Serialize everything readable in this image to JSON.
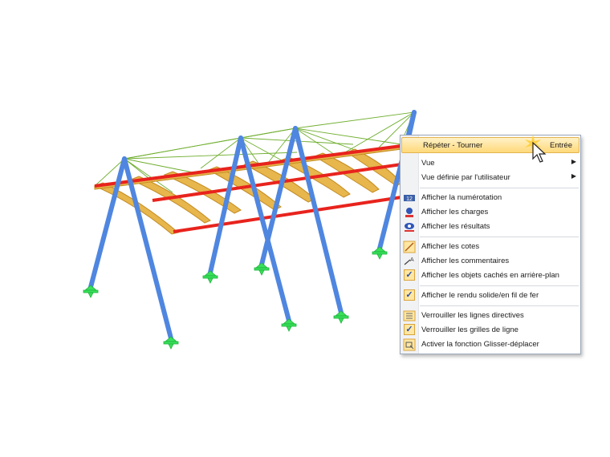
{
  "context_menu": {
    "items": [
      {
        "label": "Répéter - Tourner",
        "shortcut": "Entrée"
      },
      {
        "label": "Vue"
      },
      {
        "label": "Vue définie par l'utilisateur"
      },
      {
        "label": "Afficher la numérotation"
      },
      {
        "label": "Afficher les charges"
      },
      {
        "label": "Afficher les résultats"
      },
      {
        "label": "Afficher les cotes"
      },
      {
        "label": "Afficher les commentaires"
      },
      {
        "label": "Afficher les objets cachés en arrière-plan"
      },
      {
        "label": "Afficher le rendu solide/en fil de fer"
      },
      {
        "label": "Verrouiller les lignes directives"
      },
      {
        "label": "Verrouiller les grilles de ligne"
      },
      {
        "label": "Activer la fonction Glisser-déplacer"
      }
    ],
    "submenu_arrow": "▶",
    "check_glyph": "✓"
  },
  "colors": {
    "column": "#4f86e0",
    "red_beam": "#e8231d",
    "timber_beam": "#e7b64c",
    "cable": "#6fae2e",
    "support": "#39e05a",
    "highlight": "#ffd97a"
  },
  "icons": {
    "numbering": "numbering-icon",
    "loads": "loads-icon",
    "results": "results-icon",
    "dimensions": "dimensions-icon",
    "comments": "comments-icon",
    "guidelines": "lock-guidelines-icon",
    "drag": "drag-drop-icon"
  }
}
